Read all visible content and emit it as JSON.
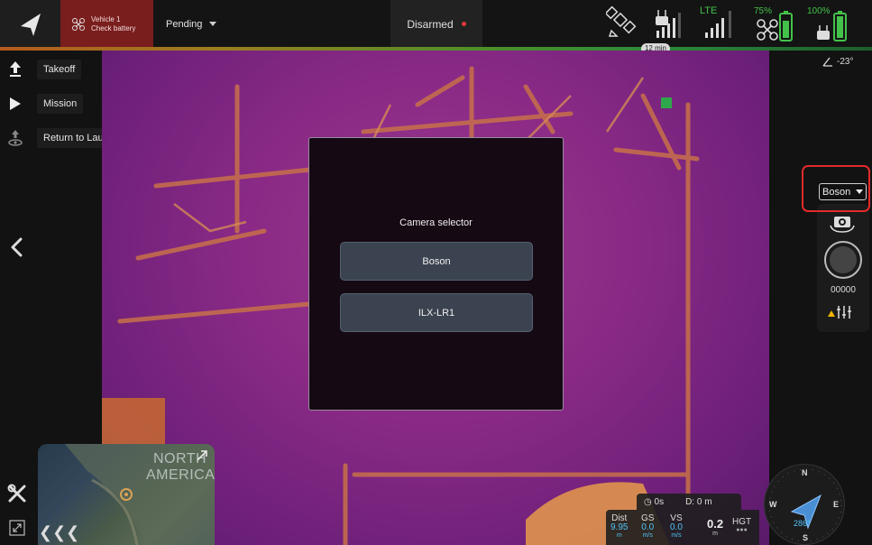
{
  "topbar": {
    "vehicle": {
      "line1": "Vehicle 1",
      "line2": "Check battery"
    },
    "flight_mode": "Pending",
    "arm_status": "Disarmed",
    "link_type": "LTE",
    "vehicle_battery": "75%",
    "controller_battery": "100%",
    "flight_time": "12 min",
    "colors": {
      "vehicle_alert_bg": "#7a1d1d",
      "ok_green": "#43c24a",
      "armed_dot": "#e53935"
    }
  },
  "commands": [
    {
      "label": "Takeoff",
      "icon": "takeoff-icon"
    },
    {
      "label": "Mission",
      "icon": "play-icon"
    },
    {
      "label": "Return to Launch",
      "icon": "return-to-launch-icon"
    }
  ],
  "modal": {
    "title": "Camera selector",
    "options": [
      "Boson",
      "ILX-LR1"
    ]
  },
  "camera": {
    "selected": "Boson",
    "tilt": "-23°",
    "counter": "00000",
    "highlight_color": "#e32b2b"
  },
  "minimap": {
    "label_line1": "NORTH",
    "label_line2": "AMERICA"
  },
  "telemetry": {
    "timer": "0s",
    "distance": "D: 0 m",
    "dist": {
      "label": "Dist",
      "value": "9.95",
      "unit": "m"
    },
    "gs": {
      "label": "GS",
      "value": "0.0",
      "unit": "m/s"
    },
    "vs": {
      "label": "VS",
      "value": "0.0",
      "unit": "m/s"
    },
    "alt": {
      "value": "0.2",
      "unit": "m"
    },
    "hgt_label": "HGT"
  },
  "compass": {
    "heading": "286°",
    "n": "N",
    "e": "E",
    "s": "S",
    "w": "W"
  }
}
